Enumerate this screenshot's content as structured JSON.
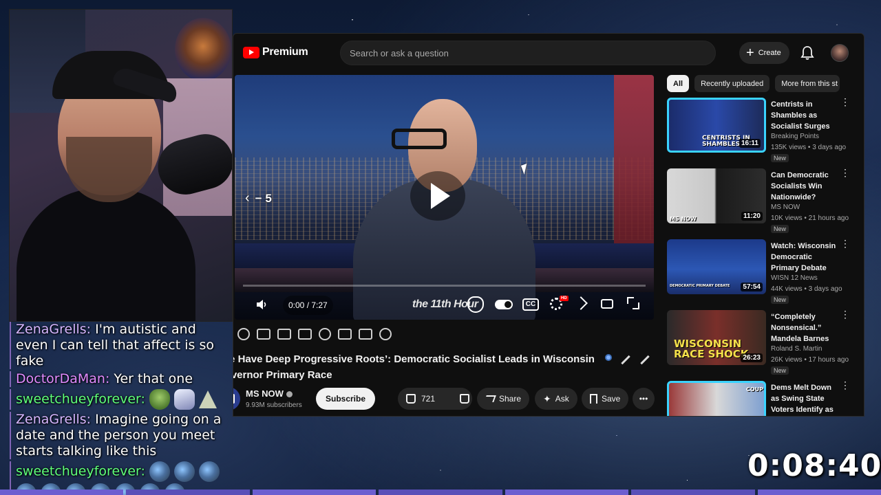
{
  "chat": [
    {
      "user": "ZenaGrells",
      "user_color": "#d6b6ff",
      "text": "I'm autistic and even I can tell that affect is so fake"
    },
    {
      "user": "DoctorDaMan",
      "user_color": "#e28bff",
      "text": "Yer that one"
    },
    {
      "user": "sweetchueyforever",
      "user_color": "#5fff7a",
      "text": ""
    },
    {
      "user": "ZenaGrells",
      "user_color": "#d6b6ff",
      "text": "Imagine going on a date and the person you meet starts talking like this"
    },
    {
      "user": "sweetchueyforever",
      "user_color": "#5fff7a",
      "text": ""
    }
  ],
  "stream_timer": "0:08:40",
  "youtube": {
    "logo_text": "Premium",
    "search_placeholder": "Search or ask a question",
    "create_label": "Create",
    "player": {
      "seek_back_label": "− 5",
      "time": "0:00 / 7:27",
      "channel_brand": "the 11th Hour",
      "progress": 0.0,
      "hd_badge": "HD",
      "cc_label": "CC"
    },
    "video_title": "‘We Have Deep Progressive Roots’: Democratic Socialist Leads in Wisconsin Governor Primary Race",
    "channel": {
      "name": "MS NOW",
      "subscribers": "9.93M subscribers",
      "subscribe_label": "Subscribe"
    },
    "actions": {
      "likes": "721",
      "share": "Share",
      "ask": "Ask",
      "save": "Save"
    },
    "chips": [
      "All",
      "Recently uploaded",
      "More from this st"
    ],
    "recommendations": [
      {
        "title": "Centrists in Shambles as Socialist Surges",
        "channel": "Breaking Points",
        "meta": "135K views • 3 days ago",
        "badge": "New",
        "duration": "16:11",
        "thumb_text": "CENTRISTS IN SHAMBLES"
      },
      {
        "title": "Can Democratic Socialists Win Nationwide?",
        "channel": "MS NOW",
        "meta": "10K views • 21 hours ago",
        "badge": "New",
        "duration": "11:20",
        "thumb_text": "MS NOW"
      },
      {
        "title": "Watch: Wisconsin Democratic Primary Debate",
        "channel": "WISN 12 News",
        "meta": "44K views • 3 days ago",
        "badge": "New",
        "duration": "57:54",
        "thumb_text": "DEMOCRATIC PRIMARY DEBATE"
      },
      {
        "title": "“Completely Nonsensical.” Mandela Barnes",
        "channel": "Roland S. Martin",
        "meta": "26K views • 17 hours ago",
        "badge": "New",
        "duration": "26:23",
        "thumb_text": "WISCONSIN RACE SHOCK"
      },
      {
        "title": "Dems Melt Down as Swing State Voters Identify as",
        "channel": "",
        "meta": "",
        "badge": "",
        "duration": "",
        "thumb_text": "COUP"
      }
    ]
  }
}
